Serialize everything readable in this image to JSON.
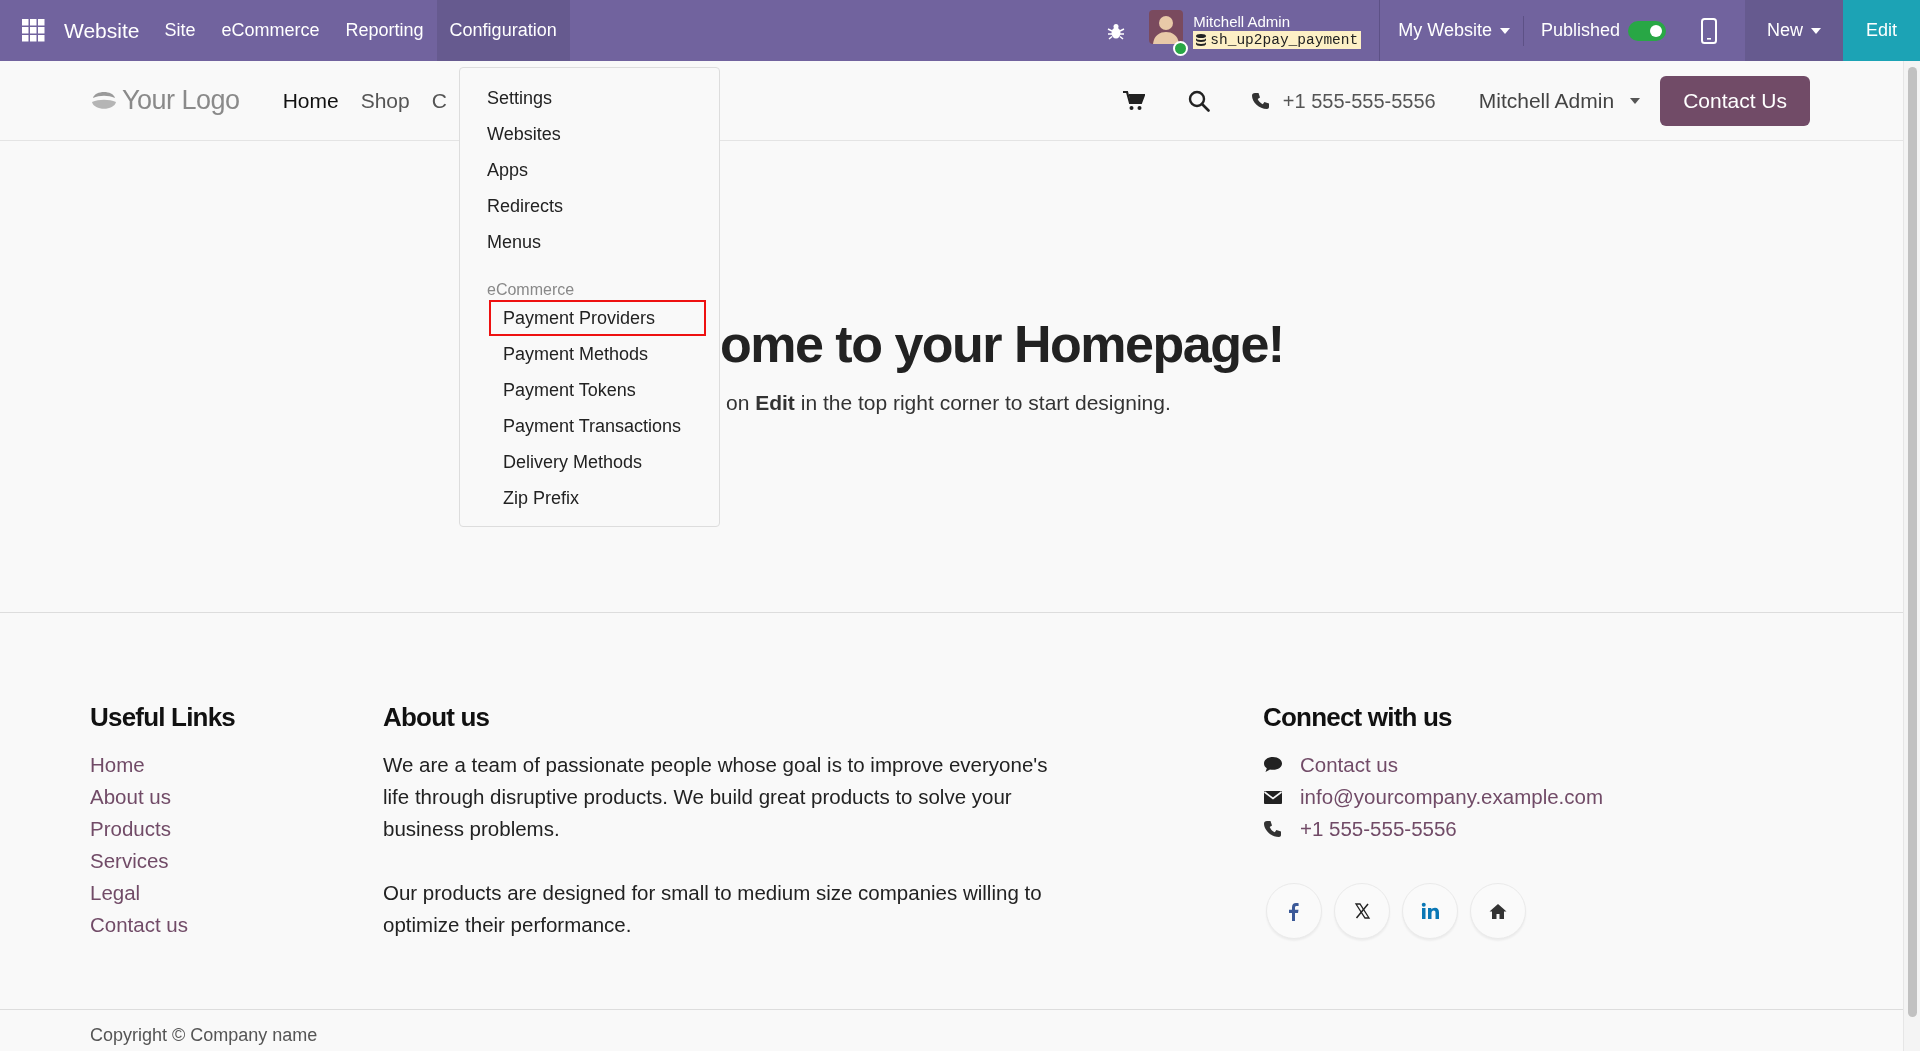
{
  "top_bar": {
    "app_name": "Website",
    "menu": [
      {
        "label": "Site",
        "selected": false
      },
      {
        "label": "eCommerce",
        "selected": false
      },
      {
        "label": "Reporting",
        "selected": false
      },
      {
        "label": "Configuration",
        "selected": true
      }
    ],
    "user": {
      "name": "Mitchell Admin",
      "online": true
    },
    "database": "sh_up2pay_payment",
    "website_switcher": "My Website",
    "published": {
      "label": "Published",
      "on": true
    },
    "new_button": "New",
    "edit_button": "Edit"
  },
  "dropdown": {
    "groups": [
      {
        "items": [
          {
            "label": "Settings",
            "highlighted": false
          },
          {
            "label": "Websites",
            "highlighted": false
          },
          {
            "label": "Apps",
            "highlighted": false
          },
          {
            "label": "Redirects",
            "highlighted": false
          },
          {
            "label": "Menus",
            "highlighted": false
          }
        ]
      },
      {
        "title": "eCommerce",
        "items": [
          {
            "label": "Payment Providers",
            "highlighted": true
          },
          {
            "label": "Payment Methods",
            "highlighted": false
          },
          {
            "label": "Payment Tokens",
            "highlighted": false
          },
          {
            "label": "Payment Transactions",
            "highlighted": false
          },
          {
            "label": "Delivery Methods",
            "highlighted": false
          },
          {
            "label": "Zip Prefix",
            "highlighted": false
          }
        ]
      }
    ]
  },
  "site_header": {
    "logo": "Your Logo",
    "nav": [
      {
        "label": "Home",
        "selected": true
      },
      {
        "label": "Shop",
        "selected": false
      },
      {
        "label": "C",
        "selected": false
      }
    ],
    "phone": "+1 555-555-5556",
    "user": "Mitchell Admin",
    "contact_button": "Contact Us"
  },
  "hero": {
    "title": "ome to your **Homepage!**",
    "subtitle": "on **Edit** in the top right corner to start designing."
  },
  "footer": {
    "useful_links": {
      "title": "Useful Links",
      "links": [
        "Home",
        "About us",
        "Products",
        "Services",
        "Legal",
        "Contact us"
      ]
    },
    "about": {
      "title": "About us",
      "paragraphs": [
        "We are a team of passionate people whose goal is to improve everyone's life through disruptive products. We build great products to solve your business problems.",
        "Our products are designed for small to medium size companies willing to optimize their performance."
      ]
    },
    "connect": {
      "title": "Connect with us",
      "items": [
        {
          "kind": "chat",
          "text": "Contact us"
        },
        {
          "kind": "email",
          "text": "info@yourcompany.example.com"
        },
        {
          "kind": "phone",
          "text": "+1 555-555-5556"
        }
      ],
      "social": [
        {
          "kind": "facebook"
        },
        {
          "kind": "x"
        },
        {
          "kind": "linkedin"
        },
        {
          "kind": "home"
        }
      ]
    }
  },
  "copyright": "Copyright © Company name"
}
